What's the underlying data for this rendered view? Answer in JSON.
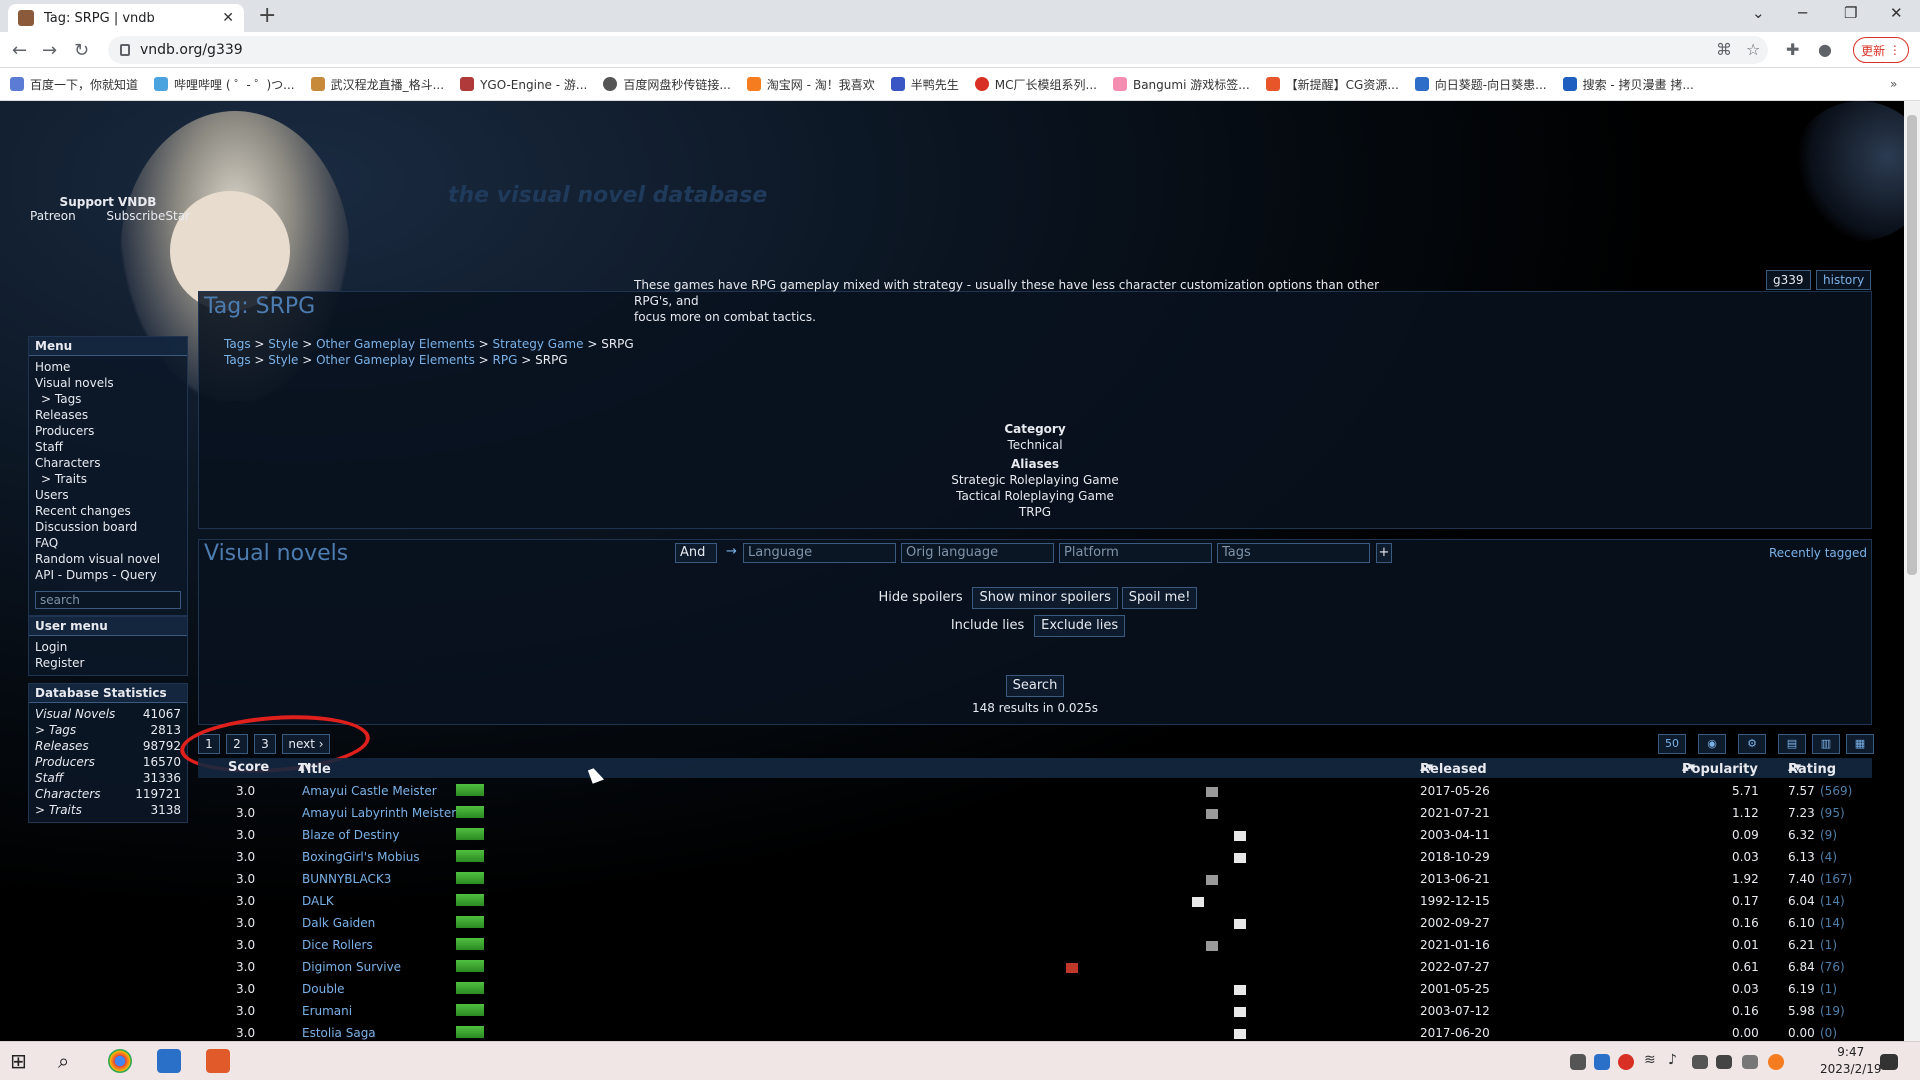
{
  "browser": {
    "tab_title": "Tag: SRPG | vndb",
    "url": "vndb.org/g339",
    "update_label": "更新",
    "bookmarks": [
      "百度一下，你就知道",
      "哔哩哔哩 ( ゜- ゜)つ...",
      "武汉程龙直播_格斗...",
      "YGO-Engine - 游...",
      "百度网盘秒传链接...",
      "淘宝网 - 淘！我喜欢",
      "半鸭先生",
      "MC厂长模组系列...",
      "Bangumi 游戏标签...",
      "【新提醒】CG资源...",
      "向日葵题-向日葵患...",
      "搜索 - 拷贝漫畫 拷..."
    ]
  },
  "site": {
    "title": "the visual novel database",
    "support_title": "Support VNDB",
    "support_links": [
      "Patreon",
      "SubscribeStar"
    ]
  },
  "menu": {
    "title": "Menu",
    "items": [
      "Home",
      "Visual novels",
      "> Tags",
      "Releases",
      "Producers",
      "Staff",
      "Characters",
      "> Traits",
      "Users",
      "Recent changes",
      "Discussion board",
      "FAQ",
      "Random visual novel",
      "API - Dumps - Query"
    ],
    "search_placeholder": "search"
  },
  "user_menu": {
    "title": "User menu",
    "items": [
      "Login",
      "Register"
    ]
  },
  "stats": {
    "title": "Database Statistics",
    "rows": [
      {
        "label": "Visual Novels",
        "value": "41067"
      },
      {
        "label": "> Tags",
        "value": "2813"
      },
      {
        "label": "Releases",
        "value": "98792"
      },
      {
        "label": "Producers",
        "value": "16570"
      },
      {
        "label": "Staff",
        "value": "31336"
      },
      {
        "label": "Characters",
        "value": "119721"
      },
      {
        "label": "> Traits",
        "value": "3138"
      }
    ]
  },
  "tag": {
    "tab_id": "g339",
    "tab_history": "history",
    "title": "Tag: SRPG",
    "breadcrumbs": [
      [
        "Tags",
        "Style",
        "Other Gameplay Elements",
        "Strategy Game",
        "SRPG"
      ],
      [
        "Tags",
        "Style",
        "Other Gameplay Elements",
        "RPG",
        "SRPG"
      ]
    ],
    "description_1": "These games have RPG gameplay mixed with strategy - usually these have less character customization options than other RPG's, and",
    "description_2": "focus more on combat tactics.",
    "category_label": "Category",
    "category_value": "Technical",
    "aliases_label": "Aliases",
    "aliases": [
      "Strategic Roleplaying Game",
      "Tactical Roleplaying Game",
      "TRPG"
    ]
  },
  "vn_section": {
    "title": "Visual novels",
    "recently_tagged": "Recently tagged",
    "hide_spoilers": "Hide spoilers",
    "show_minor_spoilers": "Show minor spoilers",
    "spoil_me": "Spoil me!",
    "include_lies": "Include lies",
    "exclude_lies": "Exclude lies",
    "and_label": "And",
    "arrow": "→",
    "filter_language": "Language",
    "filter_orig_language": "Orig language",
    "filter_platform": "Platform",
    "filter_tags": "Tags",
    "add_filter": "+",
    "search_button": "Search",
    "results_text": "148 results in 0.025s",
    "pages": [
      "1",
      "2",
      "3"
    ],
    "next": "next ›",
    "per_page": "50"
  },
  "table": {
    "col_score": "Score",
    "col_title": "Title",
    "col_released": "Released",
    "col_popularity": "Popularity",
    "col_rating": "Rating",
    "rows": [
      {
        "score": "3.0",
        "title": "Amayui Castle Meister",
        "released": "2017-05-26",
        "popularity": "5.71",
        "rating": "7.57",
        "votes": "(569)"
      },
      {
        "score": "3.0",
        "title": "Amayui Labyrinth Meister",
        "released": "2021-07-21",
        "popularity": "1.12",
        "rating": "7.23",
        "votes": "(95)"
      },
      {
        "score": "3.0",
        "title": "Blaze of Destiny",
        "released": "2003-04-11",
        "popularity": "0.09",
        "rating": "6.32",
        "votes": "(9)"
      },
      {
        "score": "3.0",
        "title": "BoxingGirl's Mobius",
        "released": "2018-10-29",
        "popularity": "0.03",
        "rating": "6.13",
        "votes": "(4)"
      },
      {
        "score": "3.0",
        "title": "BUNNYBLACK3",
        "released": "2013-06-21",
        "popularity": "1.92",
        "rating": "7.40",
        "votes": "(167)"
      },
      {
        "score": "3.0",
        "title": "DALK",
        "released": "1992-12-15",
        "popularity": "0.17",
        "rating": "6.04",
        "votes": "(14)"
      },
      {
        "score": "3.0",
        "title": "Dalk Gaiden",
        "released": "2002-09-27",
        "popularity": "0.16",
        "rating": "6.10",
        "votes": "(14)"
      },
      {
        "score": "3.0",
        "title": "Dice Rollers",
        "released": "2021-01-16",
        "popularity": "0.01",
        "rating": "6.21",
        "votes": "(1)"
      },
      {
        "score": "3.0",
        "title": "Digimon Survive",
        "released": "2022-07-27",
        "popularity": "0.61",
        "rating": "6.84",
        "votes": "(76)"
      },
      {
        "score": "3.0",
        "title": "Double",
        "released": "2001-05-25",
        "popularity": "0.03",
        "rating": "6.19",
        "votes": "(1)"
      },
      {
        "score": "3.0",
        "title": "Erumani",
        "released": "2003-07-12",
        "popularity": "0.16",
        "rating": "5.98",
        "votes": "(19)"
      },
      {
        "score": "3.0",
        "title": "Estolia Saga",
        "released": "2017-06-20",
        "popularity": "0.00",
        "rating": "0.00",
        "votes": "(0)"
      }
    ]
  },
  "taskbar": {
    "time": "9:47",
    "date": "2023/2/19"
  }
}
